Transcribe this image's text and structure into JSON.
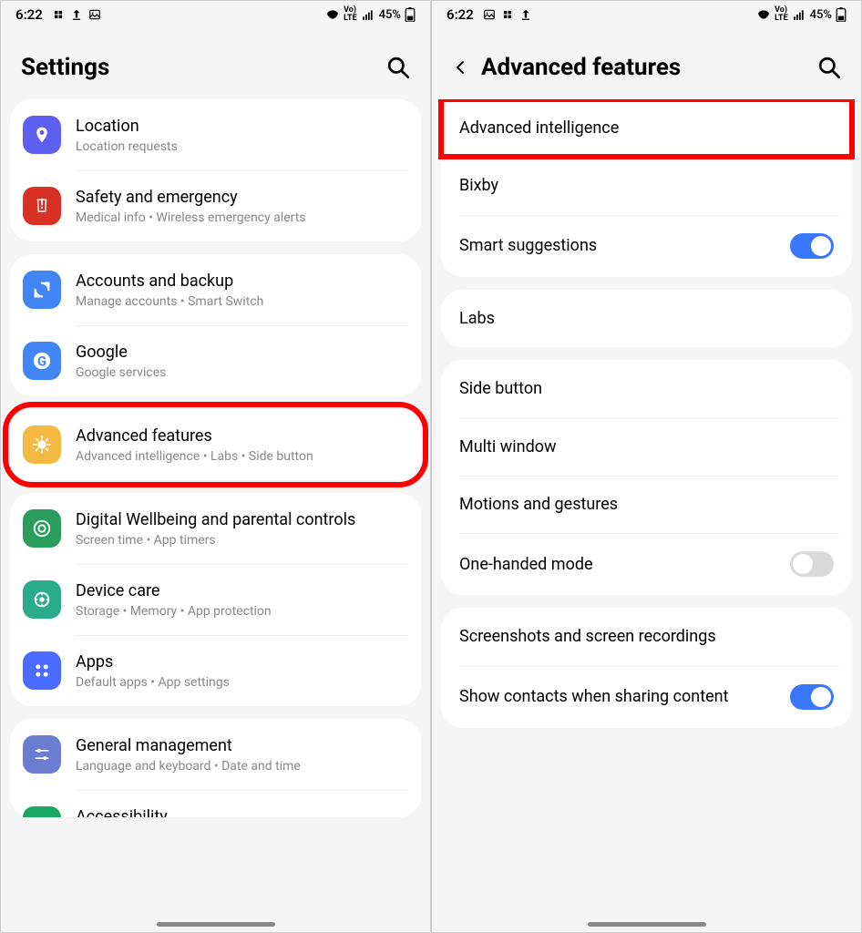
{
  "statusBar": {
    "time": "6:22",
    "battery": "45%"
  },
  "left": {
    "title": "Settings",
    "items": [
      {
        "icon": "location",
        "title": "Location",
        "sub": "Location requests",
        "color": "#5d5fef"
      },
      {
        "icon": "emergency",
        "title": "Safety and emergency",
        "sub": "Medical info  •  Wireless emergency alerts",
        "color": "#d93025"
      },
      {
        "icon": "accounts",
        "title": "Accounts and backup",
        "sub": "Manage accounts  •  Smart Switch",
        "color": "#4285f4"
      },
      {
        "icon": "google",
        "title": "Google",
        "sub": "Google services",
        "color": "#4285f4"
      },
      {
        "icon": "advanced",
        "title": "Advanced features",
        "sub": "Advanced intelligence  •  Labs  •  Side button",
        "color": "#f4b942"
      },
      {
        "icon": "wellbeing",
        "title": "Digital Wellbeing and parental controls",
        "sub": "Screen time  •  App timers",
        "color": "#2a9d5c"
      },
      {
        "icon": "devicecare",
        "title": "Device care",
        "sub": "Storage  •  Memory  •  App protection",
        "color": "#2aab8a"
      },
      {
        "icon": "apps",
        "title": "Apps",
        "sub": "Default apps  •  App settings",
        "color": "#4a6bff"
      },
      {
        "icon": "general",
        "title": "General management",
        "sub": "Language and keyboard  •  Date and time",
        "color": "#6b7dd1"
      },
      {
        "icon": "accessibility",
        "title": "Accessibility",
        "sub": "",
        "color": "#1ba863"
      }
    ]
  },
  "right": {
    "title": "Advanced features",
    "items": [
      {
        "title": "Advanced intelligence"
      },
      {
        "title": "Bixby"
      },
      {
        "title": "Smart suggestions",
        "toggle": "on"
      },
      {
        "title": "Labs"
      },
      {
        "title": "Side button"
      },
      {
        "title": "Multi window"
      },
      {
        "title": "Motions and gestures"
      },
      {
        "title": "One-handed mode",
        "toggle": "off"
      },
      {
        "title": "Screenshots and screen recordings"
      },
      {
        "title": "Show contacts when sharing content",
        "toggle": "on"
      }
    ]
  }
}
